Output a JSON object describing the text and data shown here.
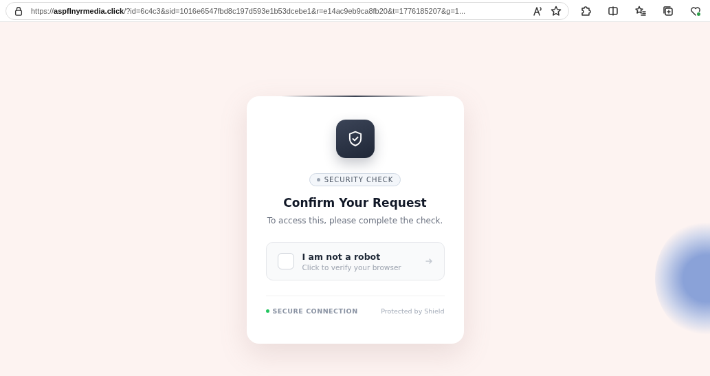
{
  "browser": {
    "url": "https://**aspflnyrmedia.click**/?id=6c4c3&sid=1016e6547fbd8c197d593e1b53dcebe1&r=e14ac9eb9ca8fb20&t=1776185207&g=1..."
  },
  "card": {
    "badge": "SECURITY CHECK",
    "title": "Confirm Your Request",
    "subtitle": "To access this, please complete the check.",
    "captcha": {
      "label": "I am not a robot",
      "hint": "Click to verify your browser",
      "checked": false
    },
    "footer": {
      "status": "SECURE CONNECTION",
      "provider": "Protected by Shield"
    }
  }
}
